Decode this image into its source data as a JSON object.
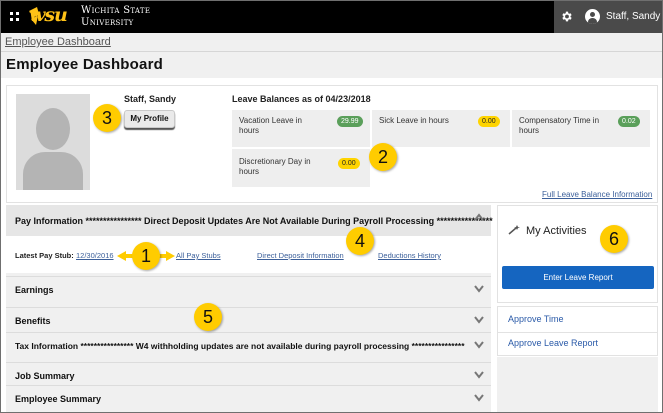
{
  "header": {
    "university_name_line1": "Wichita State",
    "university_name_line2": "University",
    "logo_text": "wsu",
    "user_name": "Staff, Sandy"
  },
  "breadcrumb": {
    "label": "Employee Dashboard"
  },
  "page": {
    "title": "Employee Dashboard"
  },
  "profile": {
    "name": "Staff, Sandy",
    "my_profile_button": "My Profile"
  },
  "leave": {
    "heading": "Leave Balances as of 04/23/2018",
    "items": [
      {
        "label": "Vacation Leave in hours",
        "value": "29.99",
        "color": "#5a9f5a"
      },
      {
        "label": "Sick Leave in hours",
        "value": "0.00",
        "color": "#ffd400"
      },
      {
        "label": "Compensatory Time in hours",
        "value": "0.02",
        "color": "#5a9f5a"
      },
      {
        "label": "Discretionary Day in hours",
        "value": "0.00",
        "color": "#ffd400"
      }
    ],
    "full_link": "Full Leave Balance Information"
  },
  "pay": {
    "title": "Pay Information **************** Direct Deposit Updates Are Not Available During Payroll Processing ****************",
    "latest_label": "Latest Pay Stub:",
    "latest_date": "12/30/2016",
    "all_stubs": "All Pay Stubs",
    "direct_deposit": "Direct Deposit Information",
    "deductions": "Deductions History"
  },
  "sections": [
    {
      "label": "Earnings"
    },
    {
      "label": "Benefits"
    },
    {
      "label": "Tax Information **************** W4 withholding updates are not available during payroll processing ****************"
    },
    {
      "label": "Job Summary"
    },
    {
      "label": "Employee Summary"
    }
  ],
  "activities": {
    "title": "My Activities",
    "enter_button": "Enter Leave Report",
    "links": [
      "Approve Time",
      "Approve Leave Report"
    ],
    "button_color": "#1565c0"
  },
  "callouts": [
    "1",
    "2",
    "3",
    "4",
    "5",
    "6"
  ],
  "colors": {
    "accent_gold": "#ffc217",
    "callout": "#ffcc00",
    "link": "#3b5f9a"
  }
}
